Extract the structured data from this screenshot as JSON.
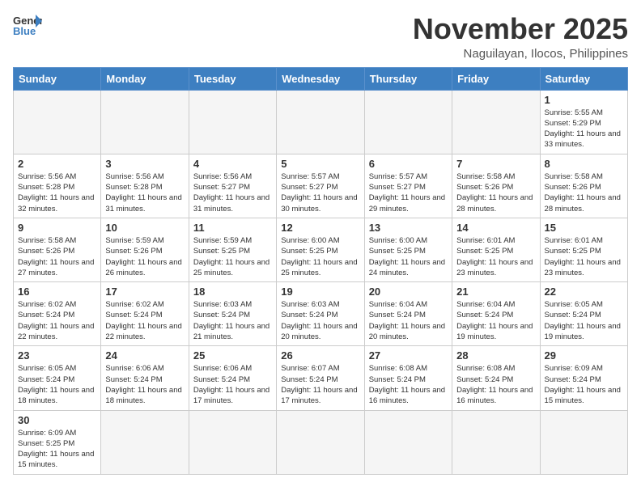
{
  "header": {
    "logo_text_general": "General",
    "logo_text_blue": "Blue",
    "month": "November 2025",
    "location": "Naguilayan, Ilocos, Philippines"
  },
  "weekdays": [
    "Sunday",
    "Monday",
    "Tuesday",
    "Wednesday",
    "Thursday",
    "Friday",
    "Saturday"
  ],
  "weeks": [
    [
      {
        "day": "",
        "empty": true
      },
      {
        "day": "",
        "empty": true
      },
      {
        "day": "",
        "empty": true
      },
      {
        "day": "",
        "empty": true
      },
      {
        "day": "",
        "empty": true
      },
      {
        "day": "",
        "empty": true
      },
      {
        "day": "1",
        "sunrise": "Sunrise: 5:55 AM",
        "sunset": "Sunset: 5:29 PM",
        "daylight": "Daylight: 11 hours and 33 minutes."
      }
    ],
    [
      {
        "day": "2",
        "sunrise": "Sunrise: 5:56 AM",
        "sunset": "Sunset: 5:28 PM",
        "daylight": "Daylight: 11 hours and 32 minutes."
      },
      {
        "day": "3",
        "sunrise": "Sunrise: 5:56 AM",
        "sunset": "Sunset: 5:28 PM",
        "daylight": "Daylight: 11 hours and 31 minutes."
      },
      {
        "day": "4",
        "sunrise": "Sunrise: 5:56 AM",
        "sunset": "Sunset: 5:27 PM",
        "daylight": "Daylight: 11 hours and 31 minutes."
      },
      {
        "day": "5",
        "sunrise": "Sunrise: 5:57 AM",
        "sunset": "Sunset: 5:27 PM",
        "daylight": "Daylight: 11 hours and 30 minutes."
      },
      {
        "day": "6",
        "sunrise": "Sunrise: 5:57 AM",
        "sunset": "Sunset: 5:27 PM",
        "daylight": "Daylight: 11 hours and 29 minutes."
      },
      {
        "day": "7",
        "sunrise": "Sunrise: 5:58 AM",
        "sunset": "Sunset: 5:26 PM",
        "daylight": "Daylight: 11 hours and 28 minutes."
      },
      {
        "day": "8",
        "sunrise": "Sunrise: 5:58 AM",
        "sunset": "Sunset: 5:26 PM",
        "daylight": "Daylight: 11 hours and 28 minutes."
      }
    ],
    [
      {
        "day": "9",
        "sunrise": "Sunrise: 5:58 AM",
        "sunset": "Sunset: 5:26 PM",
        "daylight": "Daylight: 11 hours and 27 minutes."
      },
      {
        "day": "10",
        "sunrise": "Sunrise: 5:59 AM",
        "sunset": "Sunset: 5:26 PM",
        "daylight": "Daylight: 11 hours and 26 minutes."
      },
      {
        "day": "11",
        "sunrise": "Sunrise: 5:59 AM",
        "sunset": "Sunset: 5:25 PM",
        "daylight": "Daylight: 11 hours and 25 minutes."
      },
      {
        "day": "12",
        "sunrise": "Sunrise: 6:00 AM",
        "sunset": "Sunset: 5:25 PM",
        "daylight": "Daylight: 11 hours and 25 minutes."
      },
      {
        "day": "13",
        "sunrise": "Sunrise: 6:00 AM",
        "sunset": "Sunset: 5:25 PM",
        "daylight": "Daylight: 11 hours and 24 minutes."
      },
      {
        "day": "14",
        "sunrise": "Sunrise: 6:01 AM",
        "sunset": "Sunset: 5:25 PM",
        "daylight": "Daylight: 11 hours and 23 minutes."
      },
      {
        "day": "15",
        "sunrise": "Sunrise: 6:01 AM",
        "sunset": "Sunset: 5:25 PM",
        "daylight": "Daylight: 11 hours and 23 minutes."
      }
    ],
    [
      {
        "day": "16",
        "sunrise": "Sunrise: 6:02 AM",
        "sunset": "Sunset: 5:24 PM",
        "daylight": "Daylight: 11 hours and 22 minutes."
      },
      {
        "day": "17",
        "sunrise": "Sunrise: 6:02 AM",
        "sunset": "Sunset: 5:24 PM",
        "daylight": "Daylight: 11 hours and 22 minutes."
      },
      {
        "day": "18",
        "sunrise": "Sunrise: 6:03 AM",
        "sunset": "Sunset: 5:24 PM",
        "daylight": "Daylight: 11 hours and 21 minutes."
      },
      {
        "day": "19",
        "sunrise": "Sunrise: 6:03 AM",
        "sunset": "Sunset: 5:24 PM",
        "daylight": "Daylight: 11 hours and 20 minutes."
      },
      {
        "day": "20",
        "sunrise": "Sunrise: 6:04 AM",
        "sunset": "Sunset: 5:24 PM",
        "daylight": "Daylight: 11 hours and 20 minutes."
      },
      {
        "day": "21",
        "sunrise": "Sunrise: 6:04 AM",
        "sunset": "Sunset: 5:24 PM",
        "daylight": "Daylight: 11 hours and 19 minutes."
      },
      {
        "day": "22",
        "sunrise": "Sunrise: 6:05 AM",
        "sunset": "Sunset: 5:24 PM",
        "daylight": "Daylight: 11 hours and 19 minutes."
      }
    ],
    [
      {
        "day": "23",
        "sunrise": "Sunrise: 6:05 AM",
        "sunset": "Sunset: 5:24 PM",
        "daylight": "Daylight: 11 hours and 18 minutes."
      },
      {
        "day": "24",
        "sunrise": "Sunrise: 6:06 AM",
        "sunset": "Sunset: 5:24 PM",
        "daylight": "Daylight: 11 hours and 18 minutes."
      },
      {
        "day": "25",
        "sunrise": "Sunrise: 6:06 AM",
        "sunset": "Sunset: 5:24 PM",
        "daylight": "Daylight: 11 hours and 17 minutes."
      },
      {
        "day": "26",
        "sunrise": "Sunrise: 6:07 AM",
        "sunset": "Sunset: 5:24 PM",
        "daylight": "Daylight: 11 hours and 17 minutes."
      },
      {
        "day": "27",
        "sunrise": "Sunrise: 6:08 AM",
        "sunset": "Sunset: 5:24 PM",
        "daylight": "Daylight: 11 hours and 16 minutes."
      },
      {
        "day": "28",
        "sunrise": "Sunrise: 6:08 AM",
        "sunset": "Sunset: 5:24 PM",
        "daylight": "Daylight: 11 hours and 16 minutes."
      },
      {
        "day": "29",
        "sunrise": "Sunrise: 6:09 AM",
        "sunset": "Sunset: 5:24 PM",
        "daylight": "Daylight: 11 hours and 15 minutes."
      }
    ],
    [
      {
        "day": "30",
        "sunrise": "Sunrise: 6:09 AM",
        "sunset": "Sunset: 5:25 PM",
        "daylight": "Daylight: 11 hours and 15 minutes."
      },
      {
        "day": "",
        "empty": true
      },
      {
        "day": "",
        "empty": true
      },
      {
        "day": "",
        "empty": true
      },
      {
        "day": "",
        "empty": true
      },
      {
        "day": "",
        "empty": true
      },
      {
        "day": "",
        "empty": true
      }
    ]
  ]
}
